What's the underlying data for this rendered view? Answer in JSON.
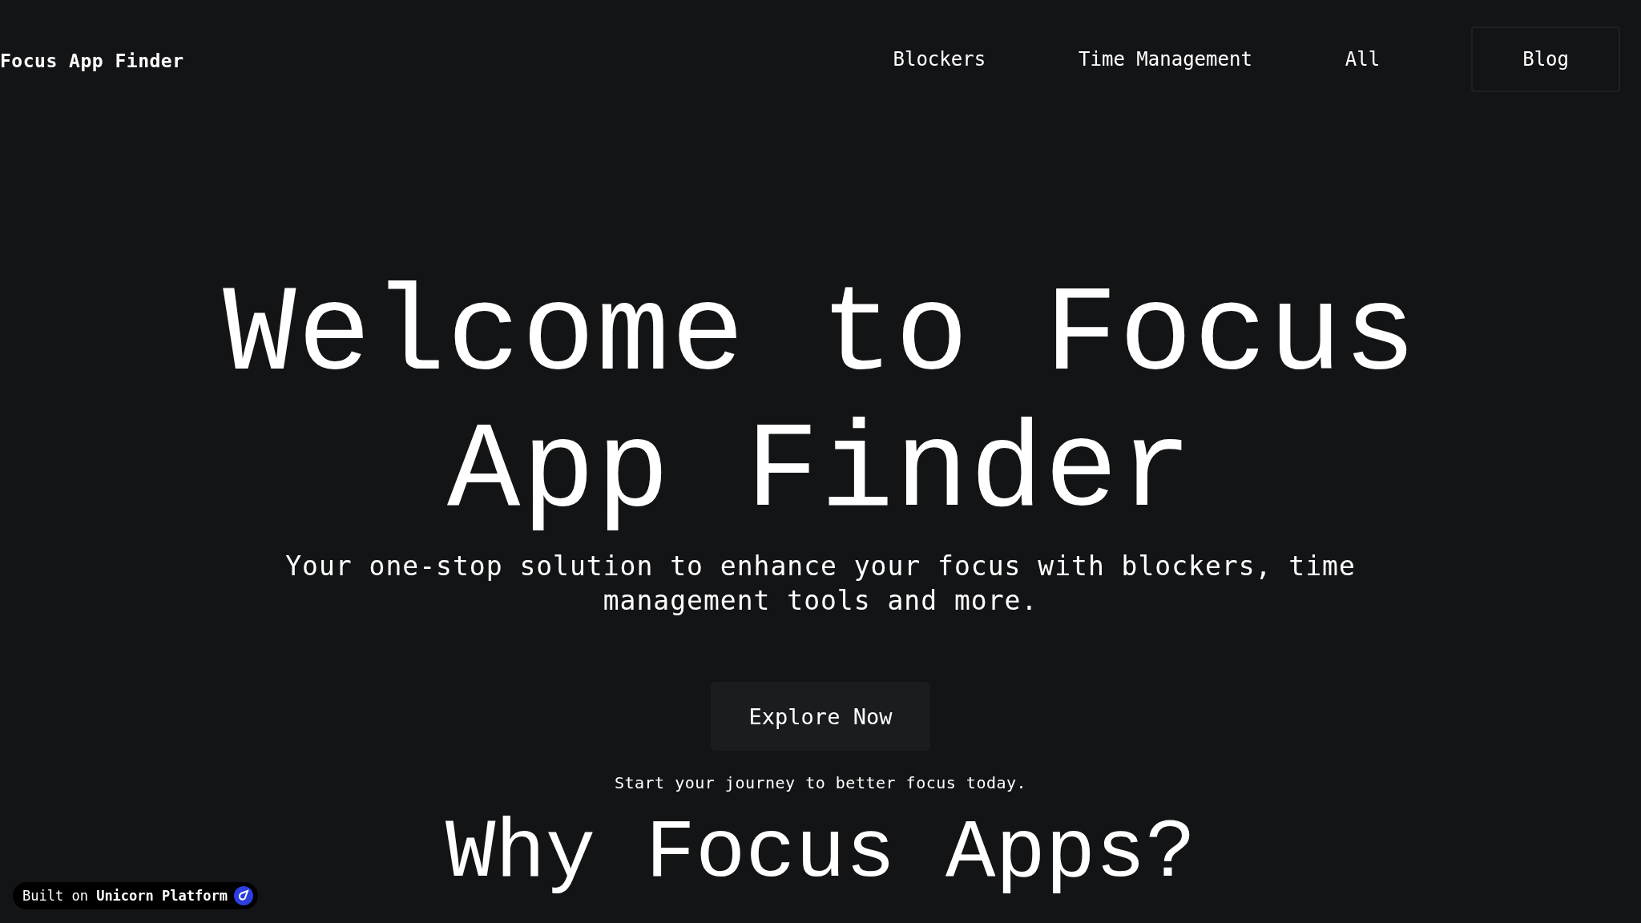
{
  "header": {
    "logo": "Focus App Finder",
    "nav": [
      {
        "label": "Blockers",
        "kind": "link"
      },
      {
        "label": "Time Management",
        "kind": "link"
      },
      {
        "label": "All",
        "kind": "link"
      },
      {
        "label": "Blog",
        "kind": "boxed"
      }
    ]
  },
  "hero": {
    "title_lines": [
      "Welcome to Focus",
      "App Finder"
    ],
    "subtitle": "Your one-stop solution to enhance your focus with blockers, time management tools and more.",
    "button": "Explore Now",
    "tagline": "Start your journey to better focus today."
  },
  "next_section": {
    "heading": "Why Focus Apps?"
  },
  "badge": {
    "prefix": "Built on",
    "brand": "Unicorn Platform"
  }
}
